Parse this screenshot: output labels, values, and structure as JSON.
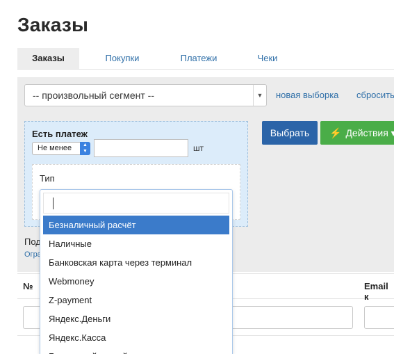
{
  "page": {
    "title": "Заказы"
  },
  "tabs": [
    {
      "label": "Заказы",
      "active": true
    },
    {
      "label": "Покупки",
      "active": false
    },
    {
      "label": "Платежи",
      "active": false
    },
    {
      "label": "Чеки",
      "active": false
    }
  ],
  "segment": {
    "value": "-- произвольный сегмент --",
    "new_selection_link": "новая выборка",
    "reset_link": "сбросить"
  },
  "condition": {
    "label": "Есть платеж",
    "operator": "Не менее",
    "count_value": "",
    "unit": "шт",
    "type_label": "Тип"
  },
  "actions": {
    "select_label": "Выбрать",
    "actions_label": "Действия",
    "actions_color": "#4aad48",
    "select_color": "#2b64a8"
  },
  "subtext": {
    "line1": "Под",
    "line2": "Огра"
  },
  "table": {
    "headers": [
      "№",
      "Email к"
    ]
  },
  "dropdown": {
    "search_value": "",
    "options": [
      {
        "label": "Безналичный расчёт",
        "selected": true
      },
      {
        "label": "Наличные",
        "selected": false
      },
      {
        "label": "Банковская карта через терминал",
        "selected": false
      },
      {
        "label": "Webmoney",
        "selected": false
      },
      {
        "label": "Z-payment",
        "selected": false
      },
      {
        "label": "Яндекс.Деньги",
        "selected": false
      },
      {
        "label": "Яндекс.Касса",
        "selected": false
      },
      {
        "label": "Банковской картой",
        "selected": false
      }
    ],
    "highlight_color": "#3b7bca"
  }
}
